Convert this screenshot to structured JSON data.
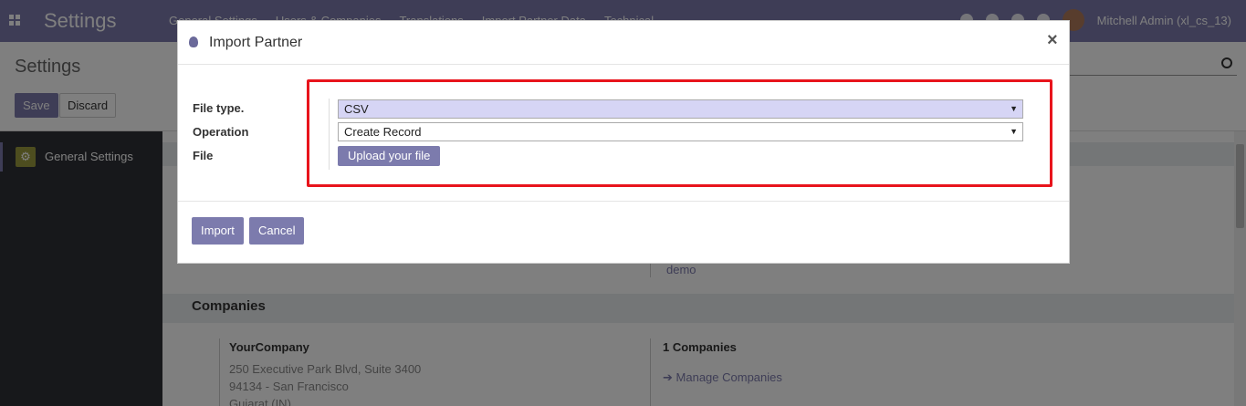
{
  "navbar": {
    "brand": "Settings",
    "menu": [
      "General Settings",
      "Users & Companies",
      "Translations",
      "Import Partner Data",
      "Technical"
    ],
    "user": "Mitchell Admin (xl_cs_13)"
  },
  "control_panel": {
    "title": "Settings",
    "save_label": "Save",
    "discard_label": "Discard"
  },
  "sidebar": {
    "items": [
      {
        "label": "General Settings",
        "icon": "gear-icon"
      }
    ]
  },
  "main": {
    "demo_link": "demo",
    "companies_heading": "Companies",
    "company_name": "YourCompany",
    "address_line1": "250 Executive Park Blvd, Suite 3400",
    "address_line2": "94134 - San Francisco",
    "address_line3": "Gujarat (IN)",
    "company_count": "1 Companies",
    "manage_link": "Manage Companies"
  },
  "modal": {
    "title": "Import Partner",
    "close_symbol": "×",
    "fields": {
      "file_type_label": "File type.",
      "file_type_value": "CSV",
      "operation_label": "Operation",
      "operation_value": "Create Record",
      "file_label": "File",
      "upload_label": "Upload your file"
    },
    "import_label": "Import",
    "cancel_label": "Cancel"
  },
  "colors": {
    "brand": "#7c7bad",
    "highlight": "#e8141c",
    "select_focus": "#d6d5f5"
  }
}
